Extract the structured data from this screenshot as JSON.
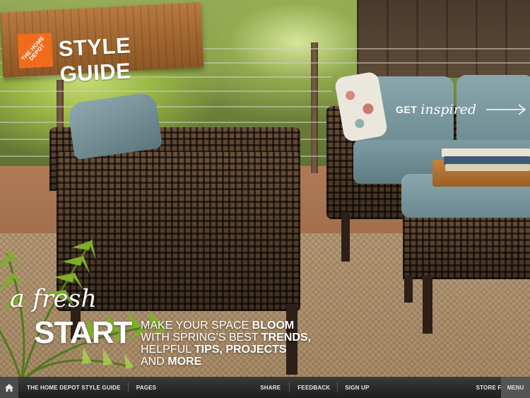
{
  "banner": {
    "logo_text": "THE HOME DEPOT",
    "title": "STYLE GUIDE"
  },
  "cta": {
    "get": "GET",
    "inspired": "inspired",
    "arrow_icon": "arrow-right-icon"
  },
  "headline": {
    "intro": "a fresh",
    "main": "START",
    "tagline": [
      {
        "plain": "MAKE YOUR SPACE ",
        "bold": "BLOOM"
      },
      {
        "plain": "WITH SPRING'S BEST ",
        "bold": "TRENDS,"
      },
      {
        "plain": "HELPFUL ",
        "bold": "TIPS, PROJECTS"
      },
      {
        "plain": "AND ",
        "bold": "MORE"
      }
    ]
  },
  "nav": {
    "home_icon": "home-icon",
    "style_guide": "THE HOME DEPOT STYLE GUIDE",
    "pages": "PAGES",
    "share": "SHARE",
    "feedback": "FEEDBACK",
    "sign_up": "SIGN UP",
    "store_finder": "STORE FINDER",
    "menu": "MENU"
  },
  "colors": {
    "brand_orange": "#f26b1d",
    "nav_bg": "#262626"
  }
}
